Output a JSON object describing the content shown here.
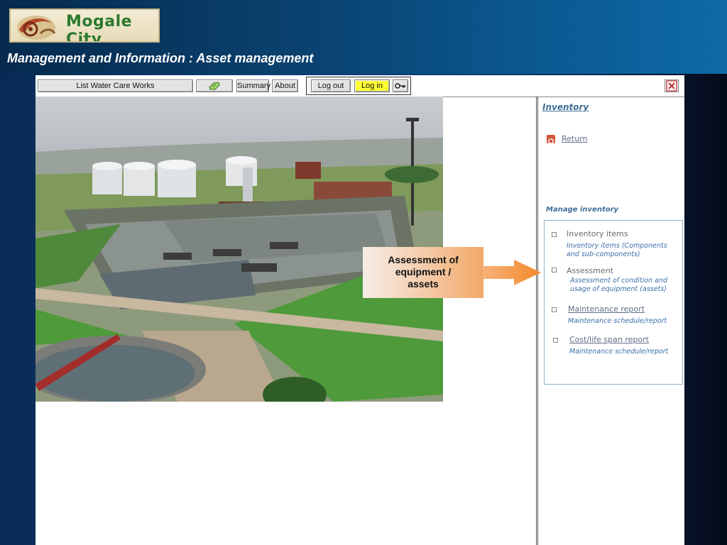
{
  "header": {
    "logo_text": "Mogale City",
    "page_heading": "Management and Information : Asset management"
  },
  "toolbar": {
    "list_label": "List Water Care Works",
    "summary_label": "Summary",
    "about_label": "About",
    "logout_label": "Log out",
    "login_label": "Log in"
  },
  "right_panel": {
    "inventory_title": "Inventory",
    "return_label": "Return",
    "manage_title": "Manage inventory",
    "items": [
      {
        "label": "Inventory items",
        "desc1": "Inventory items (Components",
        "desc2": "and sub-components)",
        "link": false
      },
      {
        "label": "Assessment",
        "desc1": "Assessment of condition and",
        "desc2": "usage of equipment (assets)",
        "link": false
      },
      {
        "label": "Maintenance report",
        "desc1": "Maintenance schedule/report",
        "desc2": "",
        "link": true
      },
      {
        "label": "Cost/life span report",
        "desc1": "Maintenance schedule/report",
        "desc2": "",
        "link": true
      }
    ]
  },
  "callout": {
    "line1": "Assessment of",
    "line2": "equipment /",
    "line3": "assets"
  },
  "colors": {
    "accent_blue": "#3f6e96",
    "login_highlight": "#ffff33",
    "callout_orange": "#f59a40"
  }
}
